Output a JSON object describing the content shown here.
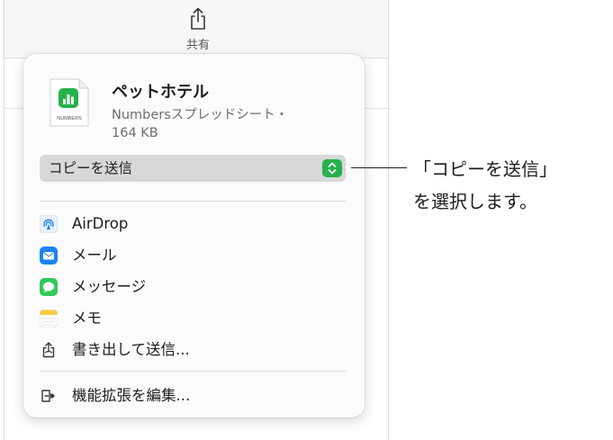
{
  "toolbar": {
    "share_label": "共有"
  },
  "popover": {
    "file": {
      "icon_caption": "NUMBERS",
      "title": "ペットホテル",
      "subtitle": "Numbersスプレッドシート・",
      "size": "164 KB"
    },
    "select": {
      "value": "コピーを送信"
    },
    "menu": [
      {
        "label": "AirDrop",
        "icon": "airdrop-icon"
      },
      {
        "label": "メール",
        "icon": "mail-icon"
      },
      {
        "label": "メッセージ",
        "icon": "messages-icon"
      },
      {
        "label": "メモ",
        "icon": "notes-icon"
      },
      {
        "label": "書き出して送信...",
        "icon": "export-share-icon"
      }
    ],
    "extensions": {
      "label": "機能拡張を編集...",
      "icon": "extensions-icon"
    }
  },
  "callout": {
    "line1": "「コピーを送信」",
    "line2": "を選択します。"
  },
  "colors": {
    "numbers_green": "#27b14b",
    "mail_blue": "#1b83f0",
    "messages_green": "#34c759",
    "notes_yellow": "#f7cd46"
  }
}
